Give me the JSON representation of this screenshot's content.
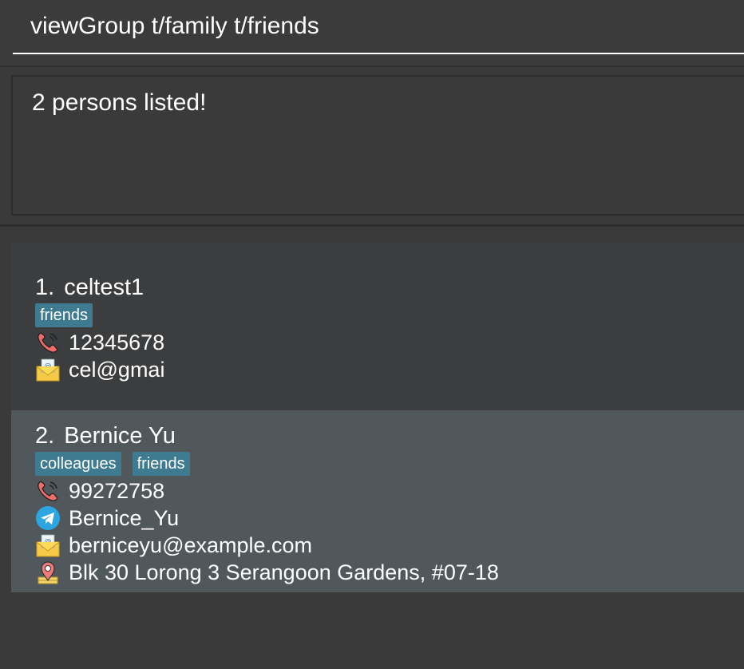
{
  "command": {
    "value": "viewGroup t/family t/friends"
  },
  "result": {
    "message": "2 persons listed!"
  },
  "persons": [
    {
      "index": "1.",
      "name": "celtest1",
      "tags": [
        "friends"
      ],
      "phone": "12345678",
      "email": "cel@gmai"
    },
    {
      "index": "2.",
      "name": "Bernice Yu",
      "tags": [
        "colleagues",
        "friends"
      ],
      "phone": "99272758",
      "telegram": "Bernice_Yu",
      "email": "berniceyu@example.com",
      "address": "Blk 30 Lorong 3 Serangoon Gardens, #07-18"
    }
  ],
  "icons": {
    "phone": "phone-icon",
    "telegram": "telegram-icon",
    "email": "email-icon",
    "address": "map-pin-icon"
  },
  "colors": {
    "tag_background": "#3e7b91",
    "selected_card": "#51585c",
    "card": "#3c3d3e",
    "window_background": "#3a3a3b"
  }
}
